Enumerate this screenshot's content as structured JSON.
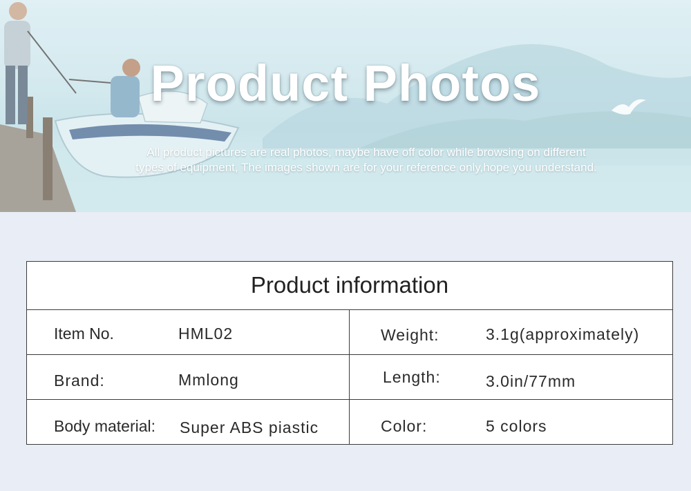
{
  "banner": {
    "title": "Product Photos",
    "subtitle_line1": "All product pictures are real photos, maybe have off color while browsing on different",
    "subtitle_line2": "types of equipment, The images shown are for your reference only,hope you understand."
  },
  "product_info": {
    "title": "Product information",
    "rows": [
      {
        "label1": "Item No.",
        "value1": "HML02",
        "label2": "Weight:",
        "value2": "3.1g(approximately)"
      },
      {
        "label1": "Brand:",
        "value1": "Mmlong",
        "label2": "Length:",
        "value2": "3.0in/77mm"
      },
      {
        "label1": "Body material:",
        "value1": "Super ABS piastic",
        "label2": "Color:",
        "value2": "5 colors"
      }
    ]
  },
  "colors": {
    "page_background": "#e9edf5",
    "banner_sky": "#cde6ec",
    "table_border": "#3a3a3a"
  }
}
